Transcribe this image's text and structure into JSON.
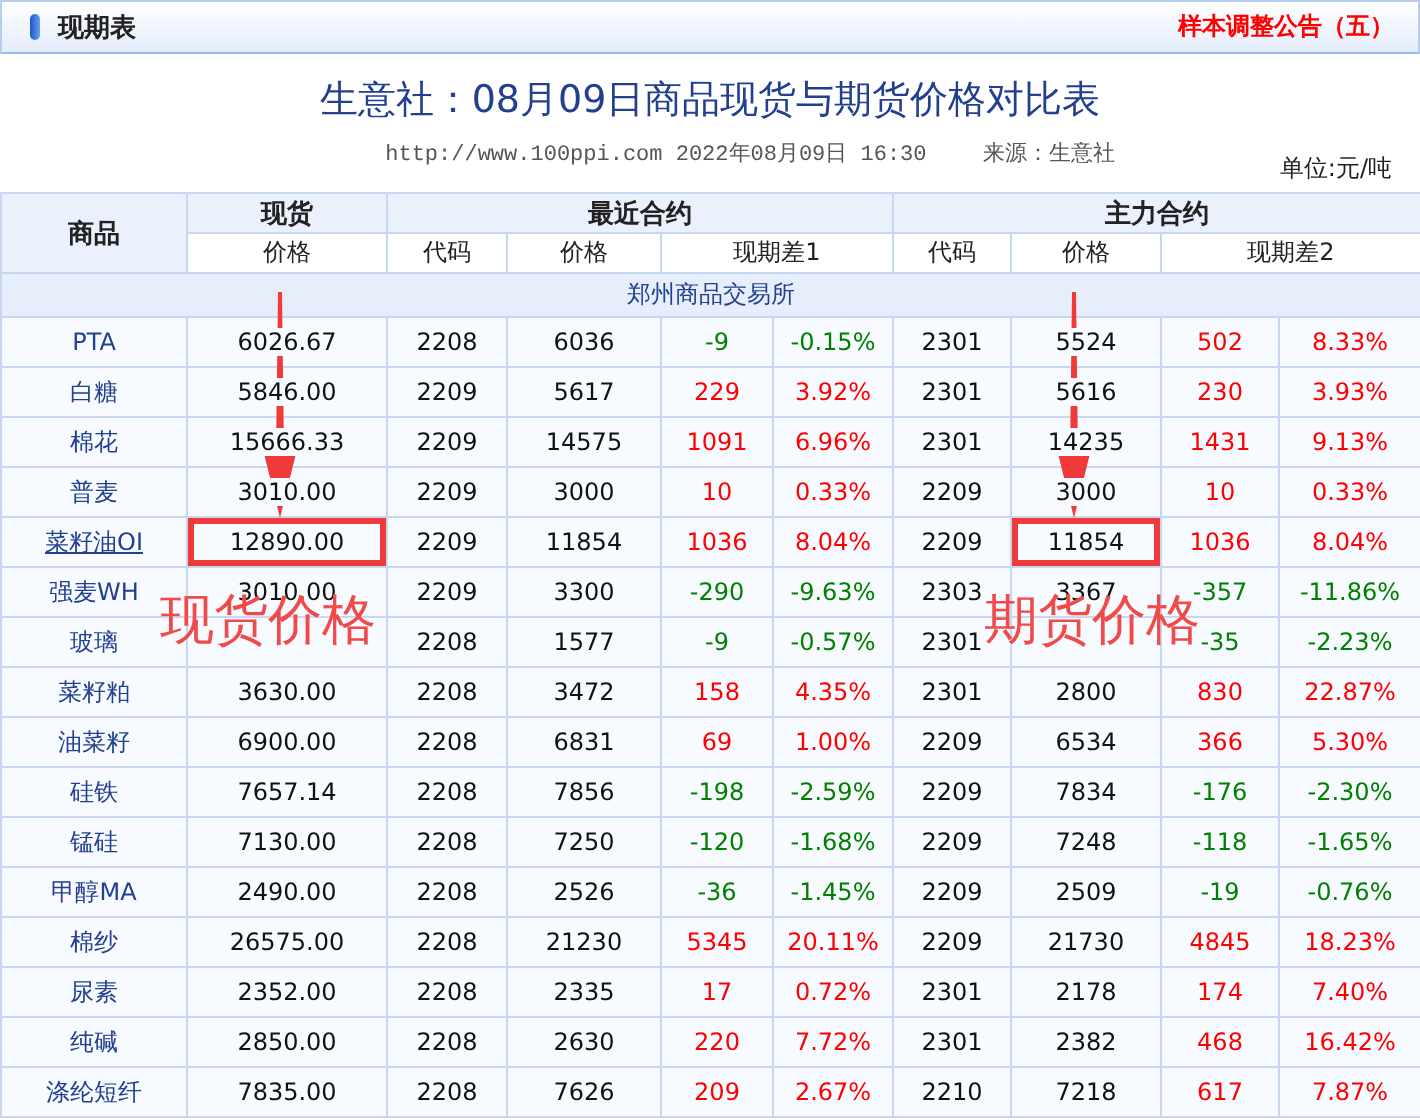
{
  "header": {
    "title": "现期表",
    "notice": "样本调整公告（五）"
  },
  "report": {
    "title": "生意社：08月09日商品现货与期货价格对比表",
    "source_line": "http://www.100ppi.com 2022年08月09日 16:30",
    "source": "来源：生意社",
    "unit": "单位:元/吨"
  },
  "table": {
    "group_headers": [
      "商品",
      "现货",
      "最近合约",
      "主力合约"
    ],
    "sub_headers": [
      "价格",
      "代码",
      "价格",
      "现期差1",
      "代码",
      "价格",
      "现期差2"
    ],
    "exchange": "郑州商品交易所",
    "rows": [
      {
        "name": "PTA",
        "link": false,
        "spot": "6026.67",
        "spot_highlight": false,
        "near_code": "2208",
        "near_price": "6036",
        "diff1": "-9",
        "pct1": "-0.15%",
        "rise1": false,
        "main_code": "2301",
        "main_price": "5524",
        "main_highlight": false,
        "diff2": "502",
        "pct2": "8.33%",
        "rise2": true
      },
      {
        "name": "白糖",
        "link": false,
        "spot": "5846.00",
        "spot_highlight": false,
        "near_code": "2209",
        "near_price": "5617",
        "diff1": "229",
        "pct1": "3.92%",
        "rise1": true,
        "main_code": "2301",
        "main_price": "5616",
        "main_highlight": false,
        "diff2": "230",
        "pct2": "3.93%",
        "rise2": true
      },
      {
        "name": "棉花",
        "link": false,
        "spot": "15666.33",
        "spot_highlight": false,
        "near_code": "2209",
        "near_price": "14575",
        "diff1": "1091",
        "pct1": "6.96%",
        "rise1": true,
        "main_code": "2301",
        "main_price": "14235",
        "main_highlight": false,
        "diff2": "1431",
        "pct2": "9.13%",
        "rise2": true
      },
      {
        "name": "普麦",
        "link": false,
        "spot": "3010.00",
        "spot_highlight": false,
        "near_code": "2209",
        "near_price": "3000",
        "diff1": "10",
        "pct1": "0.33%",
        "rise1": true,
        "main_code": "2209",
        "main_price": "3000",
        "main_highlight": false,
        "diff2": "10",
        "pct2": "0.33%",
        "rise2": true
      },
      {
        "name": "菜籽油OI",
        "link": true,
        "spot": "12890.00",
        "spot_highlight": true,
        "near_code": "2209",
        "near_price": "11854",
        "diff1": "1036",
        "pct1": "8.04%",
        "rise1": true,
        "main_code": "2209",
        "main_price": "11854",
        "main_highlight": true,
        "diff2": "1036",
        "pct2": "8.04%",
        "rise2": true
      },
      {
        "name": "强麦WH",
        "link": false,
        "spot": "3010.00",
        "spot_highlight": false,
        "near_code": "2209",
        "near_price": "3300",
        "diff1": "-290",
        "pct1": "-9.63%",
        "rise1": false,
        "main_code": "2303",
        "main_price": "3367",
        "main_highlight": false,
        "diff2": "-357",
        "pct2": "-11.86%",
        "rise2": false
      },
      {
        "name": "玻璃",
        "link": false,
        "spot_highlight": false,
        "near_code": "2208",
        "near_price": "1577",
        "diff1": "-9",
        "pct1": "-0.57%",
        "rise1": false,
        "main_code": "2301",
        "main_highlight": false,
        "diff2": "-35",
        "pct2": "-2.23%",
        "rise2": false
      },
      {
        "name": "菜籽粕",
        "link": false,
        "spot": "3630.00",
        "spot_highlight": false,
        "near_code": "2208",
        "near_price": "3472",
        "diff1": "158",
        "pct1": "4.35%",
        "rise1": true,
        "main_code": "2301",
        "main_price": "2800",
        "main_highlight": false,
        "diff2": "830",
        "pct2": "22.87%",
        "rise2": true
      },
      {
        "name": "油菜籽",
        "link": false,
        "spot": "6900.00",
        "spot_highlight": false,
        "near_code": "2208",
        "near_price": "6831",
        "diff1": "69",
        "pct1": "1.00%",
        "rise1": true,
        "main_code": "2209",
        "main_price": "6534",
        "main_highlight": false,
        "diff2": "366",
        "pct2": "5.30%",
        "rise2": true
      },
      {
        "name": "硅铁",
        "link": false,
        "spot": "7657.14",
        "spot_highlight": false,
        "near_code": "2208",
        "near_price": "7856",
        "diff1": "-198",
        "pct1": "-2.59%",
        "rise1": false,
        "main_code": "2209",
        "main_price": "7834",
        "main_highlight": false,
        "diff2": "-176",
        "pct2": "-2.30%",
        "rise2": false
      },
      {
        "name": "锰硅",
        "link": false,
        "spot": "7130.00",
        "spot_highlight": false,
        "near_code": "2208",
        "near_price": "7250",
        "diff1": "-120",
        "pct1": "-1.68%",
        "rise1": false,
        "main_code": "2209",
        "main_price": "7248",
        "main_highlight": false,
        "diff2": "-118",
        "pct2": "-1.65%",
        "rise2": false
      },
      {
        "name": "甲醇MA",
        "link": false,
        "spot": "2490.00",
        "spot_highlight": false,
        "near_code": "2208",
        "near_price": "2526",
        "diff1": "-36",
        "pct1": "-1.45%",
        "rise1": false,
        "main_code": "2209",
        "main_price": "2509",
        "main_highlight": false,
        "diff2": "-19",
        "pct2": "-0.76%",
        "rise2": false
      },
      {
        "name": "棉纱",
        "link": false,
        "spot": "26575.00",
        "spot_highlight": false,
        "near_code": "2208",
        "near_price": "21230",
        "diff1": "5345",
        "pct1": "20.11%",
        "rise1": true,
        "main_code": "2209",
        "main_price": "21730",
        "main_highlight": false,
        "diff2": "4845",
        "pct2": "18.23%",
        "rise2": true
      },
      {
        "name": "尿素",
        "link": false,
        "spot": "2352.00",
        "spot_highlight": false,
        "near_code": "2208",
        "near_price": "2335",
        "diff1": "17",
        "pct1": "0.72%",
        "rise1": true,
        "main_code": "2301",
        "main_price": "2178",
        "main_highlight": false,
        "diff2": "174",
        "pct2": "7.40%",
        "rise2": true
      },
      {
        "name": "纯碱",
        "link": false,
        "spot": "2850.00",
        "spot_highlight": false,
        "near_code": "2208",
        "near_price": "2630",
        "diff1": "220",
        "pct1": "7.72%",
        "rise1": true,
        "main_code": "2301",
        "main_price": "2382",
        "main_highlight": false,
        "diff2": "468",
        "pct2": "16.42%",
        "rise2": true
      },
      {
        "name": "涤纶短纤",
        "link": false,
        "spot": "7835.00",
        "spot_highlight": false,
        "near_code": "2208",
        "near_price": "7626",
        "diff1": "209",
        "pct1": "2.67%",
        "rise1": true,
        "main_code": "2210",
        "main_price": "7218",
        "main_highlight": false,
        "diff2": "617",
        "pct2": "7.87%",
        "rise2": true
      }
    ]
  },
  "annotations": [
    {
      "text": "现货价格"
    },
    {
      "text": "期货价格"
    }
  ]
}
